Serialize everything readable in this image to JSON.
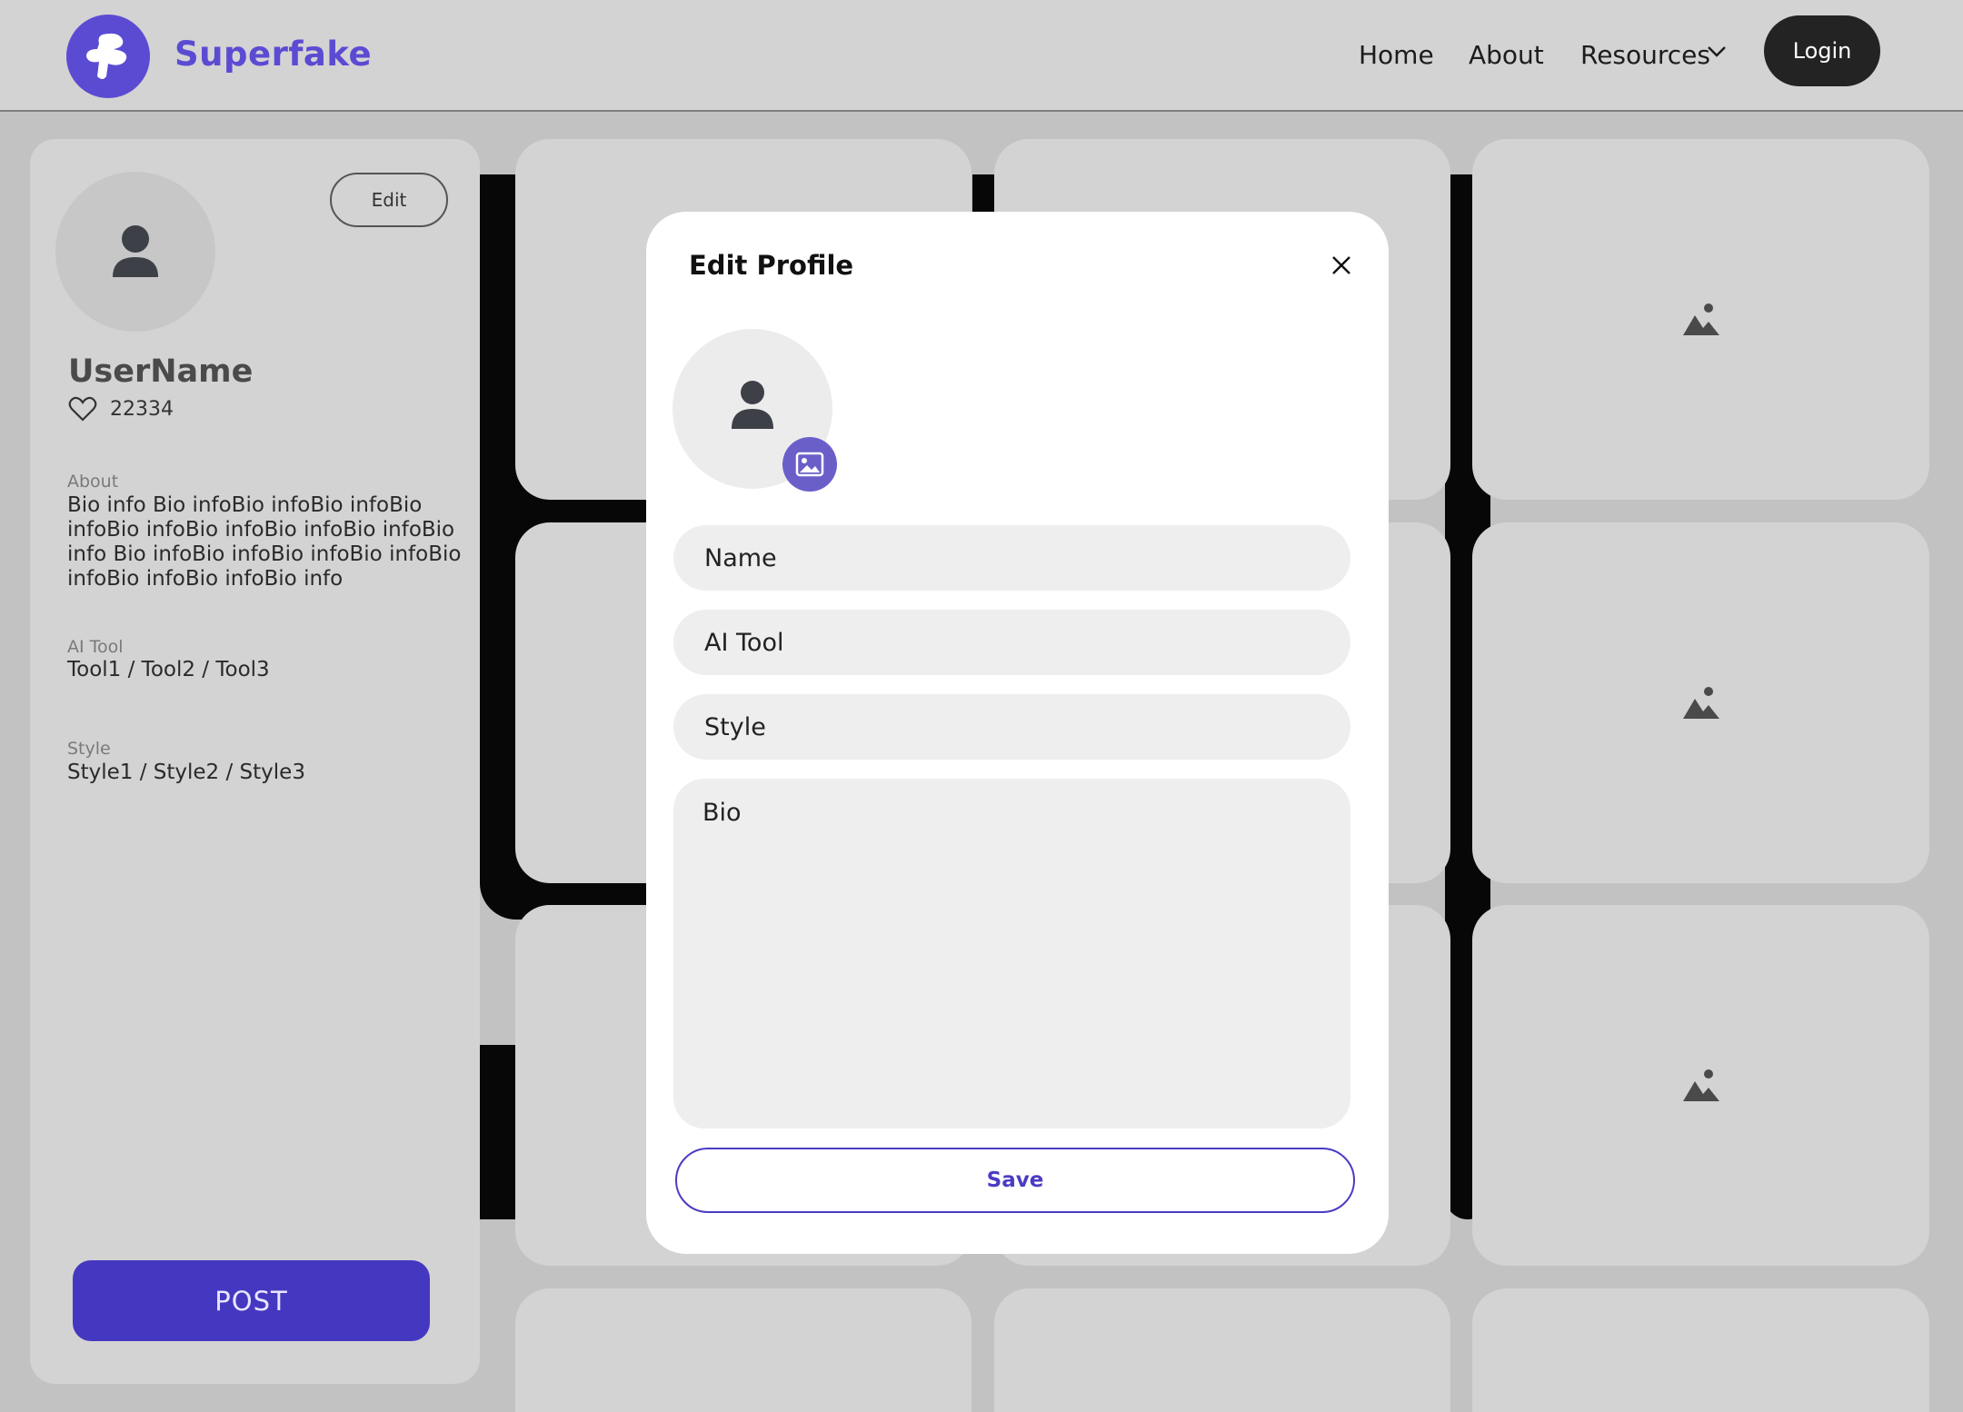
{
  "header": {
    "brand": "Superfake",
    "nav": [
      "Home",
      "About",
      "Resources"
    ],
    "login_label": "Login"
  },
  "profile": {
    "edit_label": "Edit",
    "username": "UserName",
    "likes": "22334",
    "about_label": "About",
    "about_text": "Bio info Bio infoBio infoBio infoBio infoBio infoBio infoBio infoBio infoBio info Bio infoBio infoBio infoBio infoBio infoBio infoBio infoBio info",
    "ai_tool_label": "AI Tool",
    "ai_tool_value": "Tool1 / Tool2 / Tool3",
    "style_label": "Style",
    "style_value": "Style1 / Style2 / Style3",
    "post_label": "POST"
  },
  "modal": {
    "title": "Edit Profile",
    "name_placeholder": "Name",
    "ai_tool_placeholder": "AI Tool",
    "style_placeholder": "Style",
    "bio_placeholder": "Bio",
    "save_label": "Save"
  },
  "colors": {
    "brand": "#5b4bd3",
    "post_button": "#4538c0",
    "save_outline": "#4a3cc4",
    "upload_badge": "#6a5fc9"
  }
}
